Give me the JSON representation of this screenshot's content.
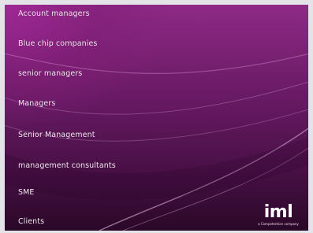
{
  "menu": {
    "items": [
      {
        "label": "Account managers"
      },
      {
        "label": "Blue chip companies"
      },
      {
        "label": "senior managers"
      },
      {
        "label": "Managers"
      },
      {
        "label": "Senior Management"
      },
      {
        "label": "management consultants"
      },
      {
        "label": "SME"
      },
      {
        "label": "Clients"
      }
    ]
  },
  "logo": {
    "mark": "iml",
    "tagline": "a Competention company"
  },
  "colors": {
    "background_top": "#8e2a86",
    "background_bottom": "#2a0828",
    "menu_text": "#f4e8f2",
    "logo_text": "#ffffff"
  }
}
